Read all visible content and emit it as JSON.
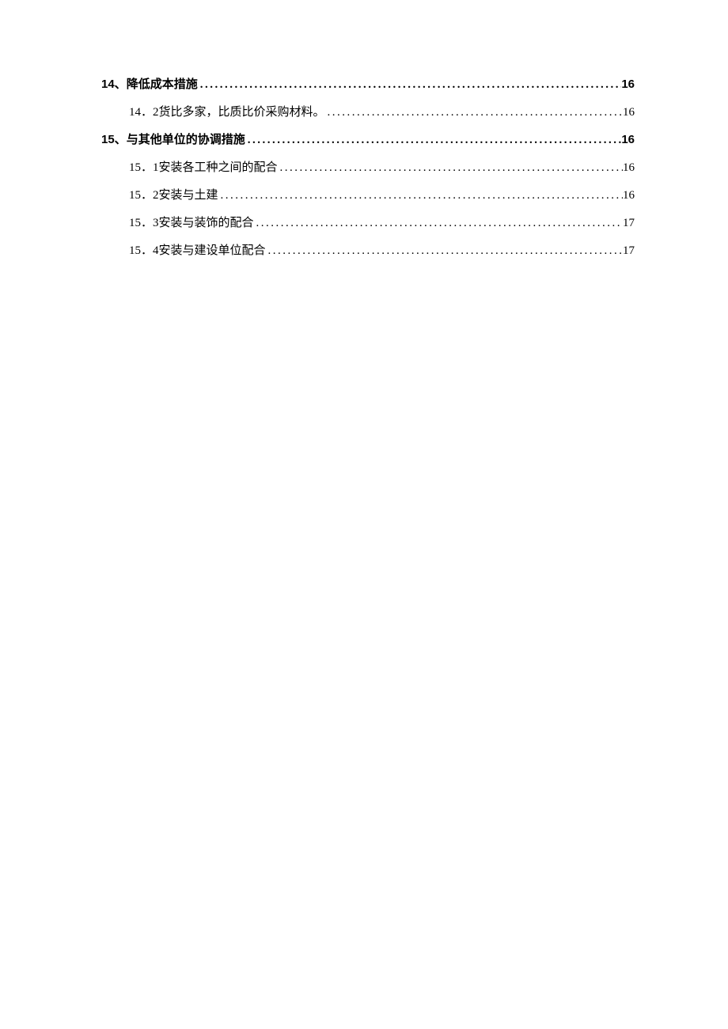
{
  "toc": [
    {
      "level": "heading",
      "num": "14、",
      "title": "降低成本措施",
      "page": "16"
    },
    {
      "level": "sub",
      "num": "14．2",
      "title": " 货比多家，比质比价采购材料。",
      "page": "16"
    },
    {
      "level": "heading",
      "num": "15、",
      "title": "与其他单位的协调措施",
      "page": "16"
    },
    {
      "level": "sub",
      "num": "15．1",
      "title": " 安装各工种之间的配合",
      "page": "16"
    },
    {
      "level": "sub",
      "num": "15．2",
      "title": " 安装与土建",
      "page": "16"
    },
    {
      "level": "sub",
      "num": "15．3",
      "title": " 安装与装饰的配合",
      "page": "17"
    },
    {
      "level": "sub",
      "num": "15．4",
      "title": " 安装与建设单位配合",
      "page": "17"
    }
  ]
}
